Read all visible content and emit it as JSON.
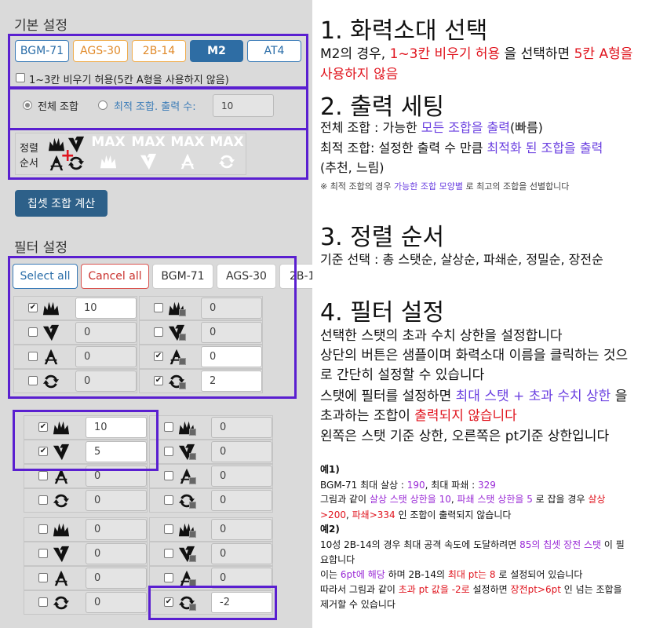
{
  "left": {
    "basic_title": "기본 설정",
    "doll_buttons": [
      "BGM-71",
      "AGS-30",
      "2B-14",
      "M2",
      "AT4"
    ],
    "disable_fill_label": "1~3칸 비우기 허용(5칸 A형을 사용하지 않음)",
    "combo_all_label": "전체 조합",
    "combo_opt_label": "최적 조합. 출력 수:",
    "combo_opt_value": "10",
    "sort_label_1": "정렬",
    "sort_label_2": "순서",
    "max_text": "MAX",
    "calc_button": "칩셋 조합 계산",
    "filter_title": "필터 설정",
    "filter_buttons": [
      "Select all",
      "Cancel all",
      "BGM-71",
      "AGS-30",
      "2B-1"
    ],
    "filter_left_values": [
      "10",
      "0",
      "0",
      "0"
    ],
    "filter_right_values": [
      "0",
      "0",
      "0",
      "2"
    ],
    "ex1_left_values": [
      "10",
      "5",
      "0",
      "0"
    ],
    "ex1_right_values": [
      "0",
      "0",
      "0",
      "0"
    ],
    "ex2_left_values": [
      "0",
      "0",
      "0",
      "0"
    ],
    "ex2_right_values": [
      "0",
      "0",
      "0",
      "-2"
    ],
    "icon_names": [
      "damage-icon",
      "break-icon",
      "accuracy-icon",
      "reload-icon"
    ]
  },
  "right": {
    "h1": "1. 화력소대 선택",
    "p1a": "M2의 경우, ",
    "p1b": "1~3칸 비우기 허용",
    "p1c": " 을 선택하면 ",
    "p1d": "5칸 A형을",
    "p1e": "사용하지 않음",
    "h2": "2. 출력 세팅",
    "p2a": "전체 조합 : 가능한 ",
    "p2b": "모든 조합을 출력",
    "p2c": "(빠름)",
    "p2d": "최적 조합:  설정한 출력 수 만큼 ",
    "p2e": "최적화 된 조합을 출력",
    "p2f": "(추천, 느림)",
    "n2a": "※ 최적 조합의 경우 ",
    "n2b": "가능한 조합 모양별",
    "n2c": " 로 최고의 조합을 선별합니다",
    "h3": "3. 정렬 순서",
    "p3": "기준 선택 : 총 스탯순, 살상순, 파쇄순, 정밀순, 장전순",
    "h4": "4. 필터 설정",
    "p4a": "선택한 스탯의 초과 수치 상한을 설정합니다",
    "p4b": "상단의 버튼은 샘플이며 화력소대 이름을 클릭하는 것으",
    "p4c": "로 간단히 설정할 수 있습니다",
    "p4d": "스탯에 필터를 설정하면 ",
    "p4e": "최대 스탯 + 초과 수치 상한",
    "p4f": " 을",
    "p4g": "초과하는 조합이 ",
    "p4h": "출력되지 않습니다",
    "p4i": "왼쪽은 스탯 기준 상한, 오른쪽은 pt기준 상한입니다",
    "ex1": "예1)",
    "e1a": "BGM-71 최대 살상 : ",
    "e1b": "190",
    "e1c": ",  최대 파쇄 : ",
    "e1d": "329",
    "e1e": "그림과 같이 ",
    "e1f": "살상 스탯 상한을 10",
    "e1g": ", ",
    "e1h": "파쇄 스탯 상한을 5",
    "e1i": " 로 잡을 경우 ",
    "e1j": "살상",
    "e1k": ">200",
    "e1l": ", ",
    "e1m": "파쇄>334",
    "e1n": " 인 조합이 출력되지 않습니다",
    "ex2": "예2)",
    "e2a": "10성 2B-14의 경우 최대 공격 속도에 도달하려면 ",
    "e2b": "85의 칩셋 장전 스탯",
    "e2c": " 이 필",
    "e2d": "요합니다",
    "e2e": "이는 ",
    "e2f": "6pt에 해당",
    "e2g": " 하며 2B-14의 ",
    "e2h": "최대 pt는 8",
    "e2i": " 로 설정되어 있습니다",
    "e2j": "따라서 그림과 같이 ",
    "e2k": "초과 pt 값을 -2로",
    "e2l": " 설정하면 ",
    "e2m": "장전pt>6pt",
    "e2n": " 인 넘는 조합을",
    "e2o": "제거할 수 있습니다"
  },
  "colors": {
    "highlight": "#5a1fd0",
    "red": "#e0141e",
    "blue_text": "#6a3fe0",
    "purple_text": "#9a2ad6",
    "primary": "#2e6da4"
  }
}
